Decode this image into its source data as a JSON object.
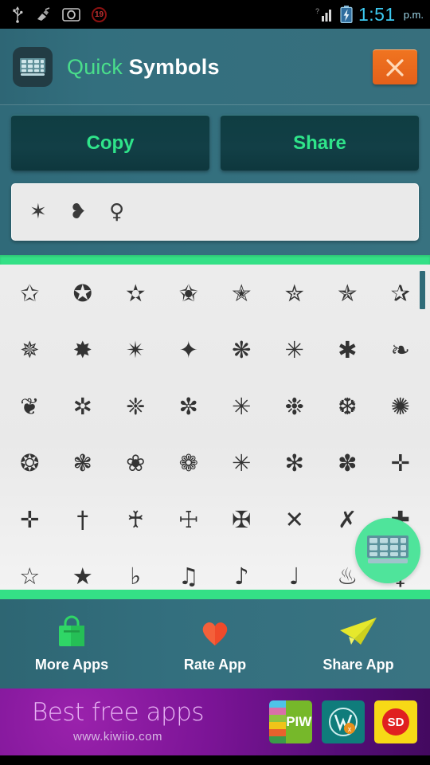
{
  "status_bar": {
    "icons": [
      "usb-icon",
      "broom-icon",
      "screenshot-icon"
    ],
    "notification_count": "19",
    "signal_icon": "signal-bars-icon",
    "battery_icon": "battery-charging-icon",
    "time": "1:51",
    "meridiem": "p.m."
  },
  "header": {
    "app_icon": "keyboard-icon",
    "title_part1": "Quick",
    "title_part2": "Symbols",
    "close_icon": "close-icon",
    "accent_green": "#4ade8b",
    "close_orange": "#e4601a",
    "teal": "#336f7e"
  },
  "actions": {
    "copy_label": "Copy",
    "share_label": "Share"
  },
  "input": {
    "value": "✶ ❥ ♀",
    "placeholder": ""
  },
  "grid": {
    "rows": [
      [
        "✩",
        "✪",
        "✫",
        "✬",
        "✭",
        "✮",
        "✯",
        "✰"
      ],
      [
        "✵",
        "✸",
        "✴",
        "✦",
        "❋",
        "✳",
        "✱",
        "❧"
      ],
      [
        "❦",
        "✲",
        "❈",
        "✼",
        "✳",
        "❉",
        "❆",
        "✺"
      ],
      [
        "❂",
        "❃",
        "❀",
        "❁",
        "✳",
        "✻",
        "✽",
        "✛"
      ],
      [
        "✛",
        "†",
        "♰",
        "☩",
        "✠",
        "✕",
        "✗",
        "✚"
      ],
      [
        "☆",
        "★",
        "♭",
        "♫",
        "♪",
        "♩",
        "♨",
        "♀"
      ]
    ],
    "scrollbar": "vertical-scrollbar",
    "fab_icon": "keyboard-icon",
    "fab_color": "#4fe49b"
  },
  "bottom_nav": {
    "items": [
      {
        "label": "More Apps",
        "icon": "shopping-bag-icon",
        "color": "#2fd666"
      },
      {
        "label": "Rate App",
        "icon": "heart-icon",
        "color": "#f04a2a"
      },
      {
        "label": "Share App",
        "icon": "paper-plane-icon",
        "color": "#e6e82c"
      }
    ]
  },
  "ad": {
    "title": "Best free apps",
    "url": "www.kiwiio.com",
    "apps": [
      {
        "name": "PIW"
      },
      {
        "name": "W"
      },
      {
        "name": "SD"
      }
    ]
  }
}
